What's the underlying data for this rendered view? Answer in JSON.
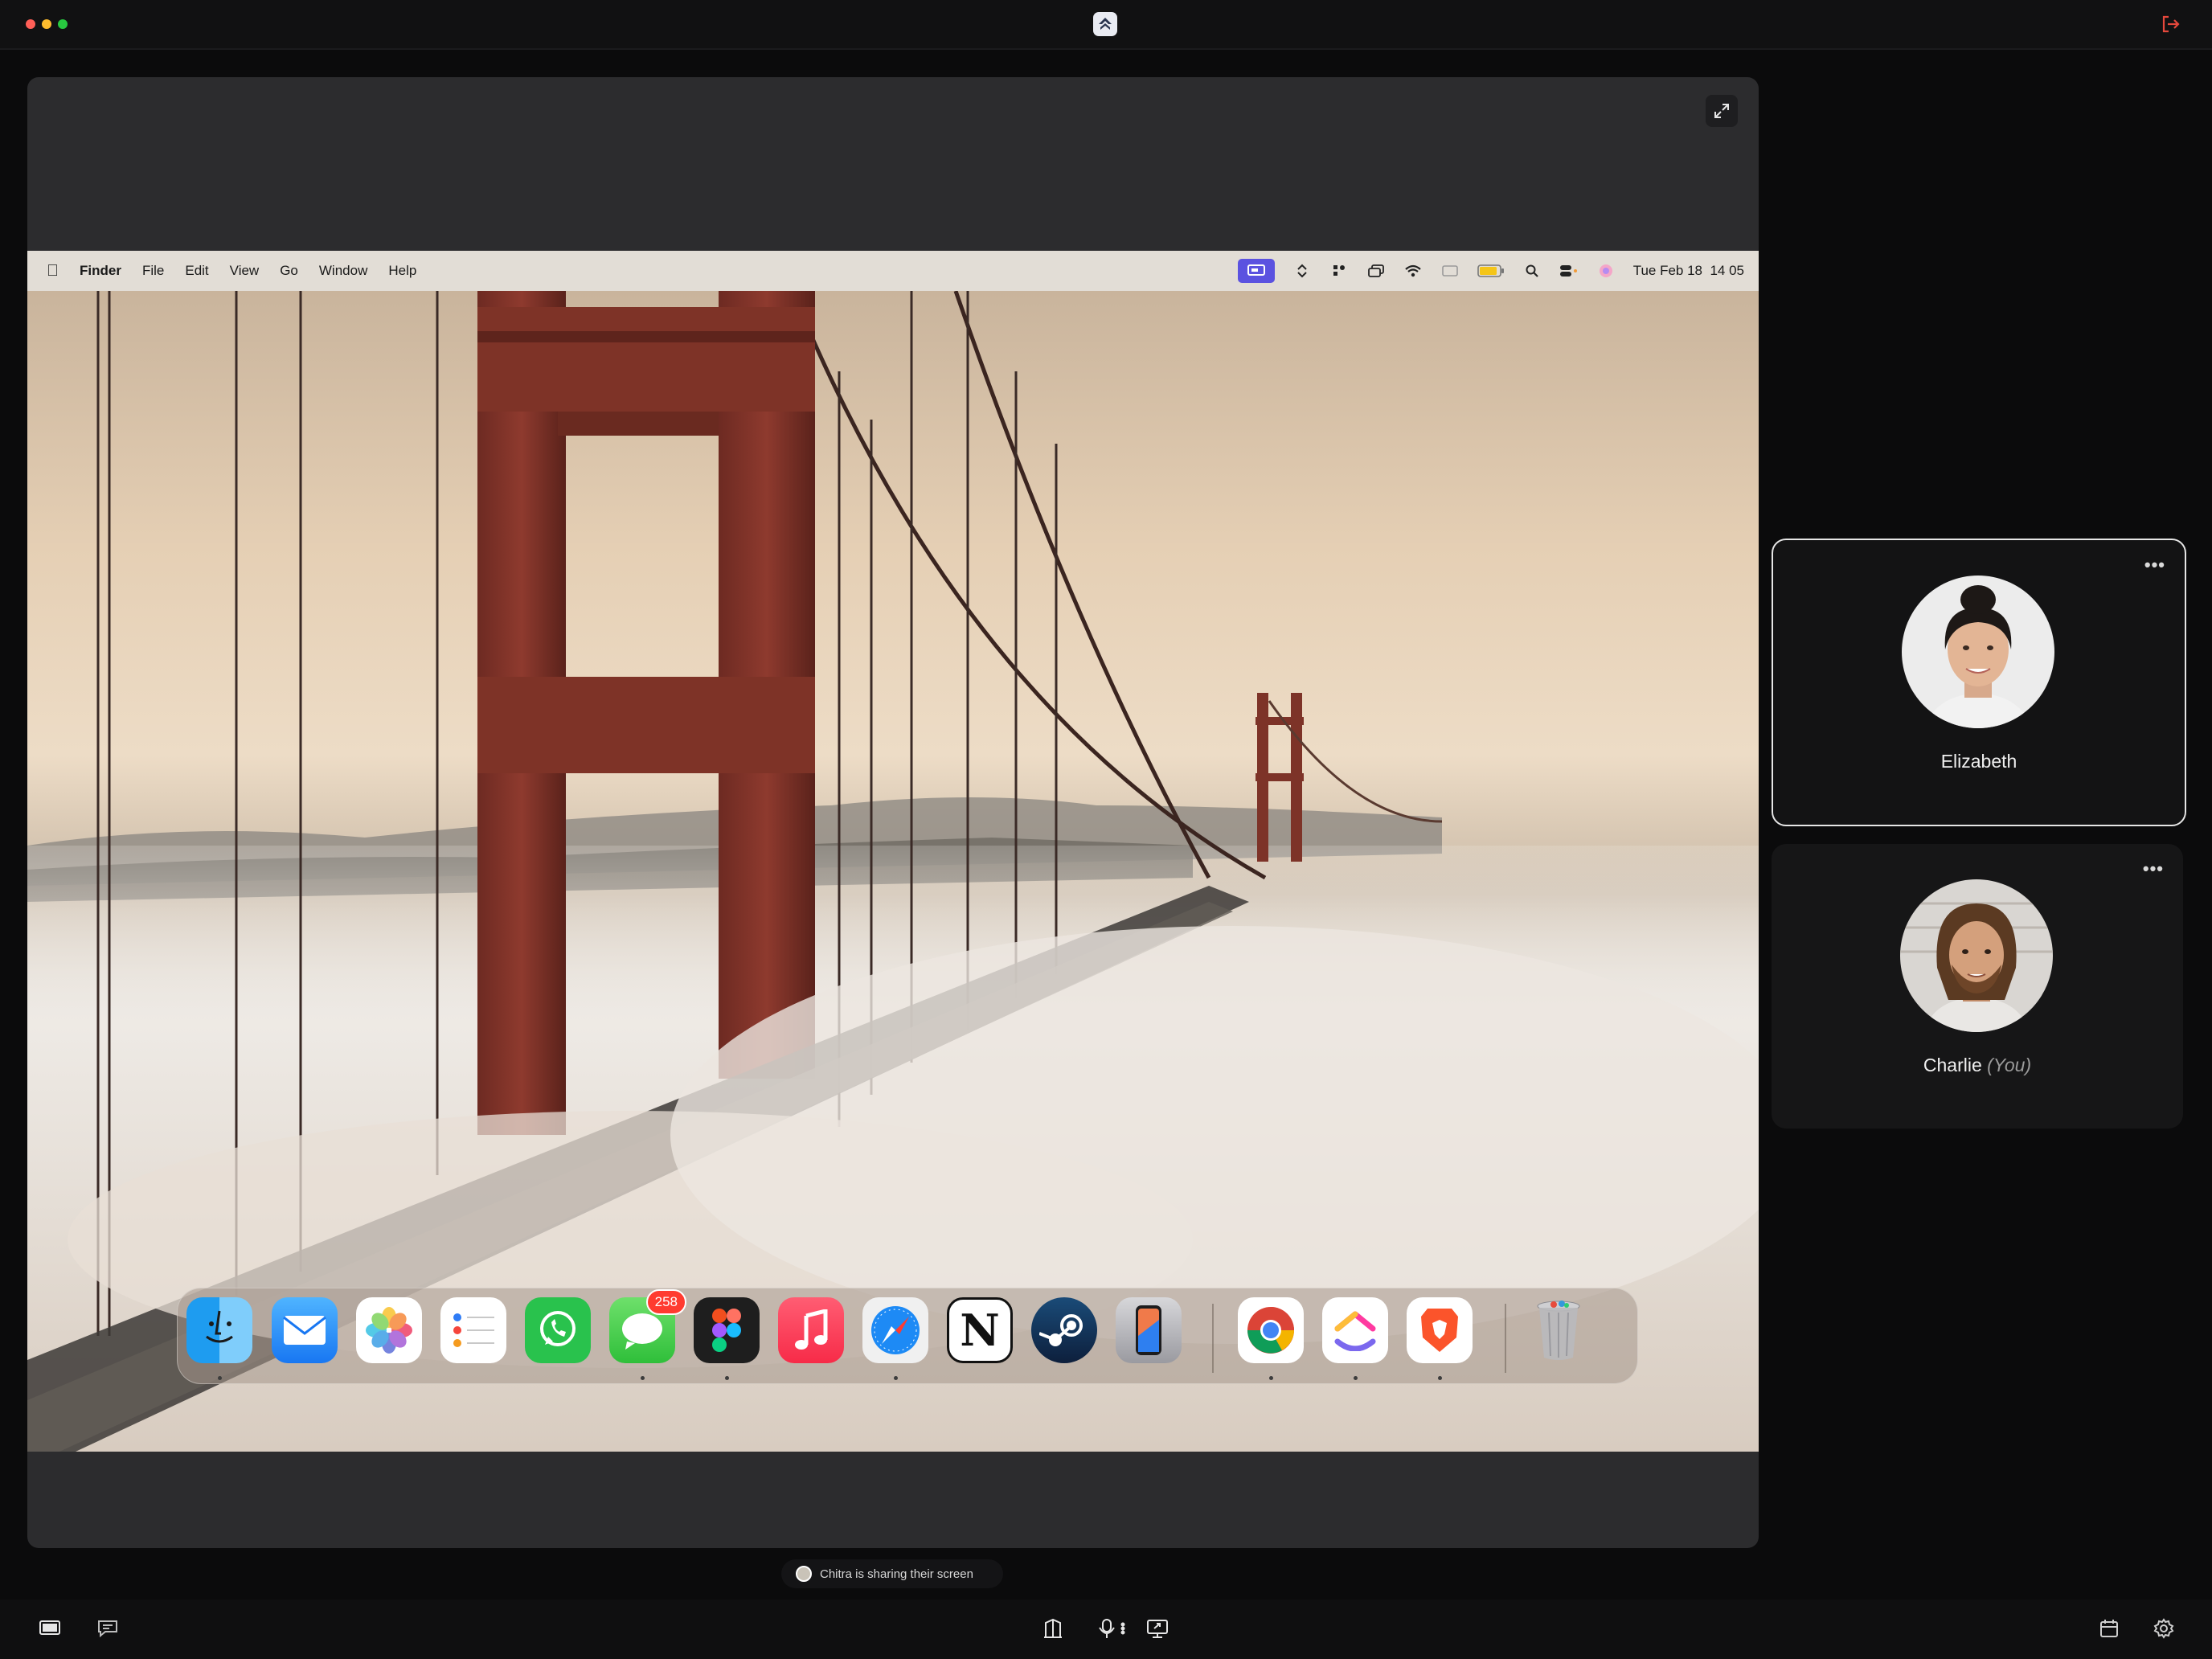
{
  "window": {
    "traffic_lights": [
      "#ff5f57",
      "#febc2e",
      "#28c840"
    ],
    "logo_icon": "app-logo-icon",
    "exit_icon": "exit-icon",
    "exit_color": "#e5483c"
  },
  "stage": {
    "expand_icon": "expand-icon"
  },
  "shared_screen": {
    "menu_bar": {
      "apple_icon": "apple-icon",
      "items": [
        "Finder",
        "File",
        "Edit",
        "View",
        "Go",
        "Window",
        "Help"
      ],
      "status_icons": [
        "screen-share-icon",
        "arrows-icon",
        "menu-extra-icon",
        "windows-icon",
        "wifi-icon",
        "display-icon",
        "battery-icon",
        "search-icon",
        "control-center-icon",
        "siri-icon"
      ],
      "clock": "Tue Feb 18  14 05"
    },
    "dock": {
      "apps": [
        {
          "name": "finder",
          "running": true
        },
        {
          "name": "mail",
          "running": false
        },
        {
          "name": "photos",
          "running": false
        },
        {
          "name": "reminders",
          "running": false
        },
        {
          "name": "whatsapp",
          "running": false
        },
        {
          "name": "messages",
          "running": true,
          "badge": "258"
        },
        {
          "name": "figma",
          "running": true
        },
        {
          "name": "music",
          "running": false
        },
        {
          "name": "safari",
          "running": true
        },
        {
          "name": "notion",
          "running": false
        },
        {
          "name": "steam",
          "running": false
        },
        {
          "name": "iphone-mirroring",
          "running": false
        },
        {
          "name": "chrome",
          "running": true
        },
        {
          "name": "clickup",
          "running": true
        },
        {
          "name": "brave",
          "running": true
        },
        {
          "name": "trash",
          "running": false
        }
      ]
    }
  },
  "participants": [
    {
      "name": "Elizabeth",
      "active": true,
      "menu": "•••"
    },
    {
      "name": "Charlie",
      "suffix": "(You)",
      "active": false,
      "menu": "•••"
    }
  ],
  "sharing_notice": "Chitra is sharing their screen",
  "toolbar": {
    "left_icons": [
      "screen-view-icon",
      "chat-icon"
    ],
    "center_icons": [
      "layout-icon",
      "microphone-icon",
      "share-screen-icon"
    ],
    "right_icons": [
      "calendar-icon",
      "settings-icon"
    ]
  }
}
